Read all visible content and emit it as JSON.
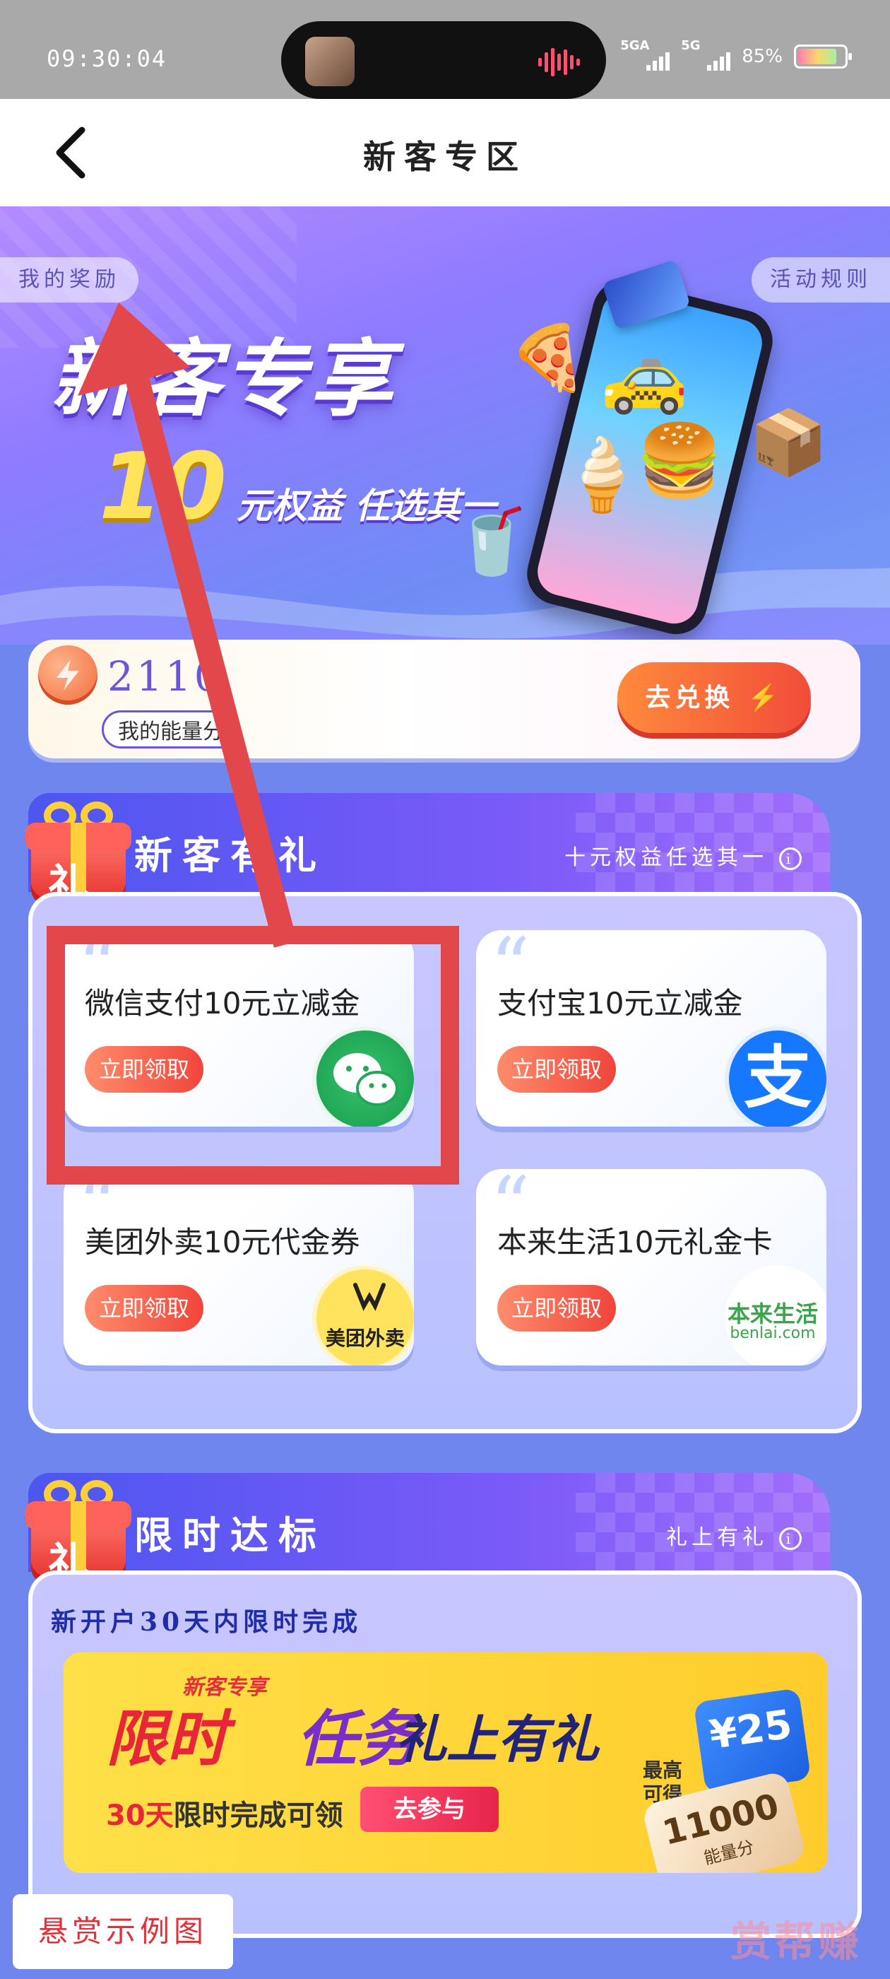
{
  "status_bar": {
    "time": "09:30:04",
    "network1": "5GA",
    "network2": "5G",
    "battery": "85%"
  },
  "nav": {
    "title": "新客专区"
  },
  "hero": {
    "my_rewards": "我的奖励",
    "rules": "活动规则",
    "title": "新客专享",
    "sub_number": "10",
    "sub_text": "元权益 任选其一"
  },
  "energy": {
    "value": "2110",
    "label": "我的能量分",
    "button": "去兑换"
  },
  "section1": {
    "title": "新客有礼",
    "hint": "十元权益任选其一",
    "gift_char": "礼",
    "coupons": [
      {
        "title": "微信支付10元立减金",
        "button": "立即领取",
        "logo": "wechat-icon"
      },
      {
        "title": "支付宝10元立减金",
        "button": "立即领取",
        "logo": "alipay-icon",
        "logo_text": "支"
      },
      {
        "title": "美团外卖10元代金券",
        "button": "立即领取",
        "logo": "meituan-icon",
        "logo_text": "美团外卖"
      },
      {
        "title": "本来生活10元礼金卡",
        "button": "立即领取",
        "logo": "benlai-icon",
        "logo_text": "本来生活",
        "logo_sub": "benlai.com"
      }
    ]
  },
  "section2": {
    "title": "限时达标",
    "hint": "礼上有礼",
    "gift_char": "礼",
    "subtitle": "新开户30天内限时完成",
    "banner": {
      "tag": "新客专享",
      "title_a": "限时",
      "title_b": "任务",
      "title_c": "礼上有礼",
      "sub_highlight": "30天",
      "sub_text": "限时完成可领",
      "button": "去参与",
      "max_label": "最高可得",
      "cash": "¥25",
      "points": "11000",
      "points_unit": "能量分"
    }
  },
  "watermark": {
    "label": "悬赏示例图",
    "brand": "赏帮赚"
  },
  "colors": {
    "highlight": "#e2474b",
    "primary": "#6a56d8",
    "accent": "#f24c3a"
  }
}
